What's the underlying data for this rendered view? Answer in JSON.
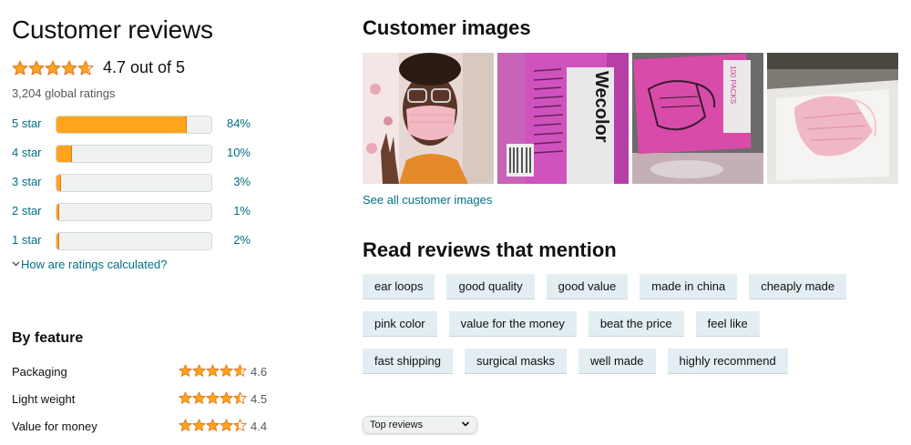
{
  "reviews": {
    "title": "Customer reviews",
    "rating_stars": 4.7,
    "rating_text": "4.7 out of 5",
    "global_ratings": "3,204 global ratings",
    "histogram": [
      {
        "label": "5 star",
        "percent_text": "84%",
        "fraction": 0.84
      },
      {
        "label": "4 star",
        "percent_text": "10%",
        "fraction": 0.1
      },
      {
        "label": "3 star",
        "percent_text": "3%",
        "fraction": 0.03
      },
      {
        "label": "2 star",
        "percent_text": "1%",
        "fraction": 0.01
      },
      {
        "label": "1 star",
        "percent_text": "2%",
        "fraction": 0.02
      }
    ],
    "how_calculated": "How are ratings calculated?"
  },
  "features": {
    "title": "By feature",
    "items": [
      {
        "label": "Packaging",
        "value": "4.6",
        "stars": 4.6
      },
      {
        "label": "Light weight",
        "value": "4.5",
        "stars": 4.5
      },
      {
        "label": "Value for money",
        "value": "4.4",
        "stars": 4.4
      }
    ]
  },
  "images": {
    "title": "Customer images",
    "see_all": "See all customer images",
    "items": [
      "selfie-with-pink-mask-photo",
      "wecolor-package-photo",
      "mask-package-photo",
      "pink-mask-on-table-photo"
    ]
  },
  "mentions": {
    "title": "Read reviews that mention",
    "rows": [
      [
        "ear loops",
        "good quality",
        "good value",
        "made in china",
        "cheaply made"
      ],
      [
        "pink color",
        "value for the money",
        "beat the price",
        "feel like"
      ],
      [
        "fast shipping",
        "surgical masks",
        "well made",
        "highly recommend"
      ]
    ]
  },
  "sort": {
    "selected": "Top reviews"
  },
  "colors": {
    "accent_link": "#007185",
    "bar_fill": "#ffa41c",
    "star": "#de7921",
    "chip_bg": "#e3eef2"
  }
}
